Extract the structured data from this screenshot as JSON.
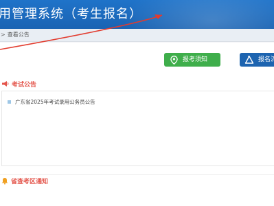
{
  "header": {
    "title": "用管理系统（考生报名）"
  },
  "breadcrumb": {
    "current": "查看公告"
  },
  "buttons": {
    "exam_notice": "报考须知",
    "registration": "报名流"
  },
  "sections": [
    {
      "title": "考试公告",
      "icon": "megaphone-icon"
    },
    {
      "title": "省查考区通知",
      "icon": "bell-icon"
    }
  ],
  "notices": [
    {
      "text": "广东省2025年考试录用公务员公告"
    }
  ],
  "colors": {
    "header_blue": "#1a63b3",
    "green_button": "#3fae4b",
    "blue_button": "#1d64b0",
    "section_red": "#e4564c",
    "bell_orange": "#f0a020",
    "annotation_arrow": "#e23b2e"
  }
}
